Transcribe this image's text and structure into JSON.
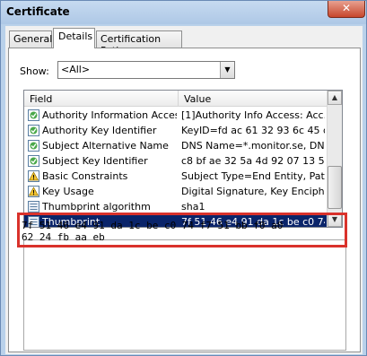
{
  "window": {
    "title": "Certificate",
    "close_label": "✕"
  },
  "tabs": [
    {
      "label": "General"
    },
    {
      "label": "Details"
    },
    {
      "label": "Certification Path"
    }
  ],
  "show": {
    "label": "Show:",
    "value": "<All>"
  },
  "list": {
    "headers": {
      "field": "Field",
      "value": "Value"
    },
    "rows": [
      {
        "icon": "cert-field-icon",
        "field": "Authority Information Access",
        "value": "[1]Authority Info Access: Acc..."
      },
      {
        "icon": "cert-field-icon",
        "field": "Authority Key Identifier",
        "value": "KeyID=fd ac 61 32 93 6c 45 d..."
      },
      {
        "icon": "cert-field-icon",
        "field": "Subject Alternative Name",
        "value": "DNS Name=*.monitor.se, DNS..."
      },
      {
        "icon": "cert-field-icon",
        "field": "Subject Key Identifier",
        "value": "c8 bf ae 32 5a 4d 92 07 13 5a ..."
      },
      {
        "icon": "warning-extension-icon",
        "field": "Basic Constraints",
        "value": "Subject Type=End Entity, Pat..."
      },
      {
        "icon": "warning-extension-icon",
        "field": "Key Usage",
        "value": "Digital Signature, Key Encipher..."
      },
      {
        "icon": "property-icon",
        "field": "Thumbprint algorithm",
        "value": "sha1"
      },
      {
        "icon": "property-icon",
        "field": "Thumbprint",
        "value": "7f 51 46 e4 91 da 1c be c0 74 ...",
        "selected": true
      }
    ]
  },
  "detail": {
    "line1": "7f 51 46 e4 91 da 1c be c0 74 f7 51 bb f0 a0",
    "line2": "62 24 fb aa eb"
  }
}
